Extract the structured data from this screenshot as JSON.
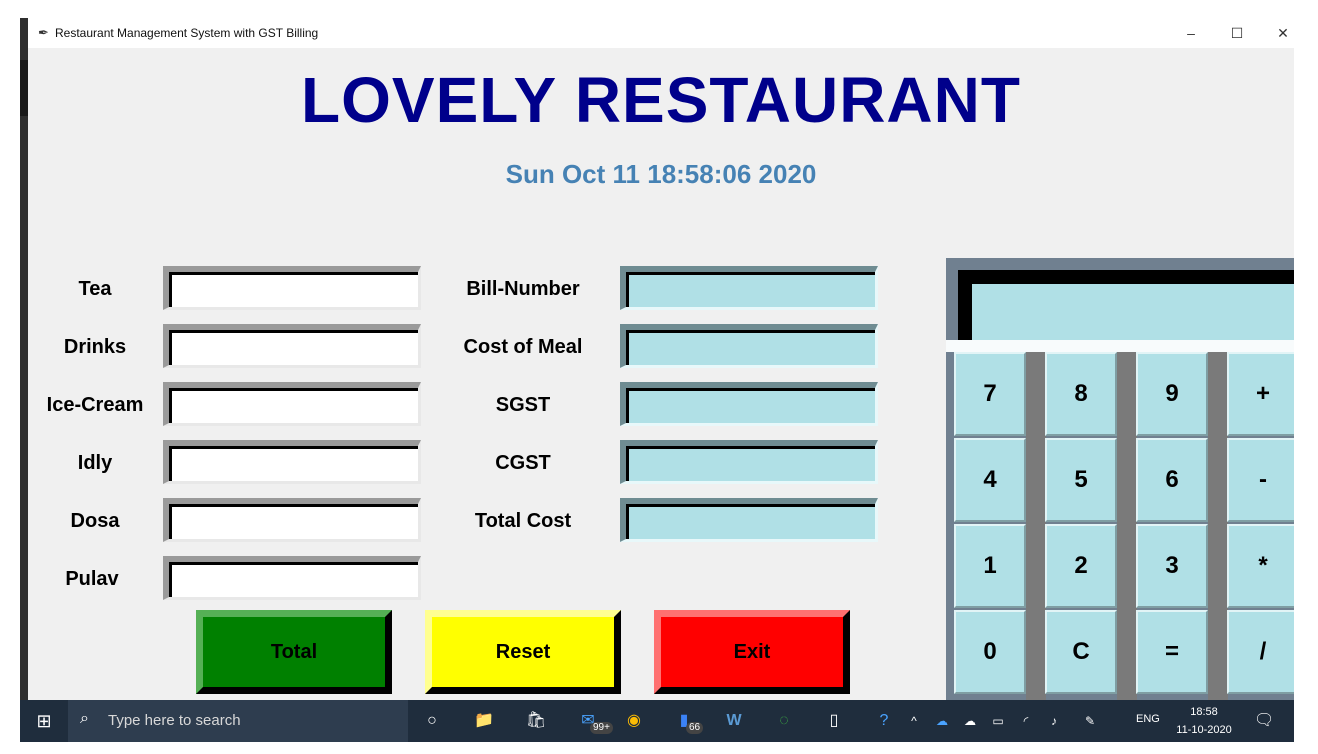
{
  "window": {
    "title": "Restaurant Management System with GST Billing",
    "icon": "feather-icon",
    "controls": {
      "minimize": "–",
      "maximize": "☐",
      "close": "✕"
    }
  },
  "header": {
    "title": "LOVELY RESTAURANT",
    "datetime": "Sun Oct 11 18:58:06 2020"
  },
  "items": [
    {
      "label": "Tea",
      "value": ""
    },
    {
      "label": "Drinks",
      "value": ""
    },
    {
      "label": "Ice-Cream",
      "value": ""
    },
    {
      "label": "Idly",
      "value": ""
    },
    {
      "label": "Dosa",
      "value": ""
    },
    {
      "label": "Pulav",
      "value": ""
    }
  ],
  "billing": [
    {
      "label": "Bill-Number",
      "value": ""
    },
    {
      "label": "Cost of Meal",
      "value": ""
    },
    {
      "label": "SGST",
      "value": ""
    },
    {
      "label": "CGST",
      "value": ""
    },
    {
      "label": "Total Cost",
      "value": ""
    }
  ],
  "actions": {
    "total": "Total",
    "reset": "Reset",
    "exit": "Exit"
  },
  "calculator": {
    "display": "",
    "keys": [
      "7",
      "8",
      "9",
      "+",
      "4",
      "5",
      "6",
      "-",
      "1",
      "2",
      "3",
      "*",
      "0",
      "C",
      "=",
      "/"
    ]
  },
  "taskbar": {
    "start": "⊞",
    "search_placeholder": "Type here to search",
    "apps": [
      {
        "icon": "task-view-icon",
        "glyph": "○"
      },
      {
        "icon": "file-explorer-icon",
        "glyph": "📁"
      },
      {
        "icon": "store-icon",
        "glyph": "🛍"
      },
      {
        "icon": "mail-icon",
        "glyph": "✉",
        "badge": "99+"
      },
      {
        "icon": "chrome-icon",
        "glyph": "◉"
      },
      {
        "icon": "phone-icon",
        "glyph": "▮",
        "badge": "66"
      },
      {
        "icon": "word-icon",
        "glyph": "W"
      },
      {
        "icon": "circle-app-icon",
        "glyph": "◌"
      },
      {
        "icon": "document-icon",
        "glyph": "▯"
      },
      {
        "icon": "help-icon",
        "glyph": "?"
      }
    ],
    "tray": [
      "^",
      "☁",
      "☁",
      "▭",
      "◜",
      "♪",
      "✎"
    ],
    "language": "ENG",
    "time": "18:58",
    "date": "11-10-2020",
    "notification_icon": "🗨"
  }
}
